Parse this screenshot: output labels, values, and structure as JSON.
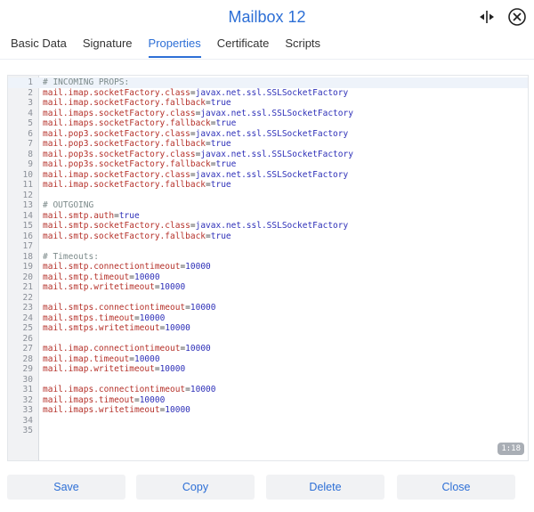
{
  "window": {
    "title": "Mailbox 12"
  },
  "icons": {
    "expand": "resize-horizontal-icon",
    "close": "close-icon"
  },
  "tabs": [
    {
      "label": "Basic Data",
      "active": false
    },
    {
      "label": "Signature",
      "active": false
    },
    {
      "label": "Properties",
      "active": true
    },
    {
      "label": "Certificate",
      "active": false
    },
    {
      "label": "Scripts",
      "active": false
    }
  ],
  "editor": {
    "cursor_position": "1:18",
    "lines": [
      {
        "n": "1",
        "type": "comment",
        "text": "# INCOMING PROPS:"
      },
      {
        "n": "2",
        "type": "prop",
        "key": "mail.imap.socketFactory.class",
        "value": "javax.net.ssl.SSLSocketFactory"
      },
      {
        "n": "3",
        "type": "prop",
        "key": "mail.imap.socketFactory.fallback",
        "value": "true"
      },
      {
        "n": "4",
        "type": "prop",
        "key": "mail.imaps.socketFactory.class",
        "value": "javax.net.ssl.SSLSocketFactory"
      },
      {
        "n": "5",
        "type": "prop",
        "key": "mail.imaps.socketFactory.fallback",
        "value": "true"
      },
      {
        "n": "6",
        "type": "prop",
        "key": "mail.pop3.socketFactory.class",
        "value": "javax.net.ssl.SSLSocketFactory"
      },
      {
        "n": "7",
        "type": "prop",
        "key": "mail.pop3.socketFactory.fallback",
        "value": "true"
      },
      {
        "n": "8",
        "type": "prop",
        "key": "mail.pop3s.socketFactory.class",
        "value": "javax.net.ssl.SSLSocketFactory"
      },
      {
        "n": "9",
        "type": "prop",
        "key": "mail.pop3s.socketFactory.fallback",
        "value": "true"
      },
      {
        "n": "10",
        "type": "prop",
        "key": "mail.imap.socketFactory.class",
        "value": "javax.net.ssl.SSLSocketFactory"
      },
      {
        "n": "11",
        "type": "prop",
        "key": "mail.imap.socketFactory.fallback",
        "value": "true"
      },
      {
        "n": "12",
        "type": "blank",
        "text": ""
      },
      {
        "n": "13",
        "type": "comment",
        "text": "# OUTGOING"
      },
      {
        "n": "14",
        "type": "prop",
        "key": "mail.smtp.auth",
        "value": "true"
      },
      {
        "n": "15",
        "type": "prop",
        "key": "mail.smtp.socketFactory.class",
        "value": "javax.net.ssl.SSLSocketFactory"
      },
      {
        "n": "16",
        "type": "prop",
        "key": "mail.smtp.socketFactory.fallback",
        "value": "true"
      },
      {
        "n": "17",
        "type": "blank",
        "text": ""
      },
      {
        "n": "18",
        "type": "comment",
        "text": "# Timeouts:"
      },
      {
        "n": "19",
        "type": "prop",
        "key": "mail.smtp.connectiontimeout",
        "value": "10000"
      },
      {
        "n": "20",
        "type": "prop",
        "key": "mail.smtp.timeout",
        "value": "10000"
      },
      {
        "n": "21",
        "type": "prop",
        "key": "mail.smtp.writetimeout",
        "value": "10000"
      },
      {
        "n": "22",
        "type": "blank",
        "text": ""
      },
      {
        "n": "23",
        "type": "prop",
        "key": "mail.smtps.connectiontimeout",
        "value": "10000"
      },
      {
        "n": "24",
        "type": "prop",
        "key": "mail.smtps.timeout",
        "value": "10000"
      },
      {
        "n": "25",
        "type": "prop",
        "key": "mail.smtps.writetimeout",
        "value": "10000"
      },
      {
        "n": "26",
        "type": "blank",
        "text": ""
      },
      {
        "n": "27",
        "type": "prop",
        "key": "mail.imap.connectiontimeout",
        "value": "10000"
      },
      {
        "n": "28",
        "type": "prop",
        "key": "mail.imap.timeout",
        "value": "10000"
      },
      {
        "n": "29",
        "type": "prop",
        "key": "mail.imap.writetimeout",
        "value": "10000"
      },
      {
        "n": "30",
        "type": "blank",
        "text": ""
      },
      {
        "n": "31",
        "type": "prop",
        "key": "mail.imaps.connectiontimeout",
        "value": "10000"
      },
      {
        "n": "32",
        "type": "prop",
        "key": "mail.imaps.timeout",
        "value": "10000"
      },
      {
        "n": "33",
        "type": "prop",
        "key": "mail.imaps.writetimeout",
        "value": "10000"
      },
      {
        "n": "34",
        "type": "blank",
        "text": ""
      },
      {
        "n": "35",
        "type": "blank",
        "text": ""
      }
    ]
  },
  "footer": {
    "save_label": "Save",
    "copy_label": "Copy",
    "delete_label": "Delete",
    "close_label": "Close"
  }
}
